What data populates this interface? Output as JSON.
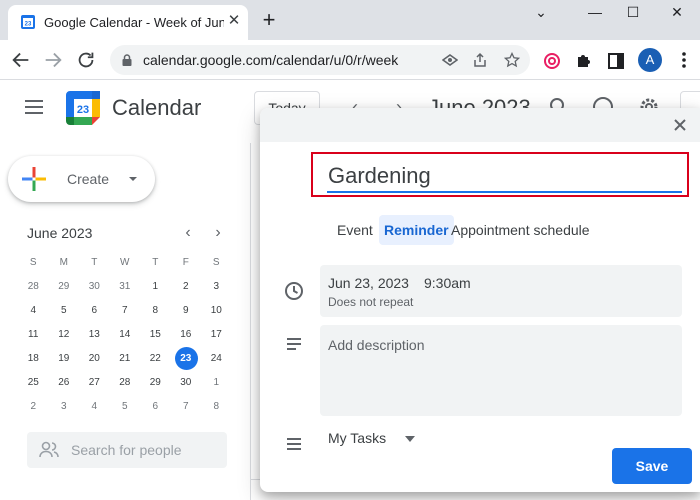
{
  "browser": {
    "tab_title": "Google Calendar - Week of June",
    "new_tab_symbol": "+",
    "window_buttons": [
      "⌄",
      "—",
      "☐",
      "✕"
    ],
    "url": "calendar.google.com/calendar/u/0/r/week",
    "profile_initial": "A",
    "colors": {
      "tabstrip": "#dee1e6",
      "avatar": "#1a5fb4"
    }
  },
  "app": {
    "name": "Calendar",
    "logo_day": "23",
    "today_label": "Today",
    "header_date": "June 2023",
    "create_label": "Create",
    "search_people_placeholder": "Search for people",
    "colors": {
      "accent": "#1a73e8",
      "highlight_box": "#d9001b"
    }
  },
  "mini_calendar": {
    "title": "June 2023",
    "prev": "‹",
    "next": "›",
    "weekdays": [
      "S",
      "M",
      "T",
      "W",
      "T",
      "F",
      "S"
    ],
    "weeks": [
      [
        "28",
        "29",
        "30",
        "31",
        "1",
        "2",
        "3"
      ],
      [
        "4",
        "5",
        "6",
        "7",
        "8",
        "9",
        "10"
      ],
      [
        "11",
        "12",
        "13",
        "14",
        "15",
        "16",
        "17"
      ],
      [
        "18",
        "19",
        "20",
        "21",
        "22",
        "23",
        "24"
      ],
      [
        "25",
        "26",
        "27",
        "28",
        "29",
        "30",
        "1"
      ],
      [
        "2",
        "3",
        "4",
        "5",
        "6",
        "7",
        "8"
      ]
    ],
    "today": "23"
  },
  "dialog": {
    "title_value": "Gardening",
    "tabs": [
      "Event",
      "Reminder",
      "Appointment schedule"
    ],
    "active_tab": "Reminder",
    "date": "Jun 23, 2023",
    "time": "9:30am",
    "repeat": "Does not repeat",
    "description_placeholder": "Add description",
    "tasks_list": "My Tasks",
    "save_label": "Save"
  }
}
